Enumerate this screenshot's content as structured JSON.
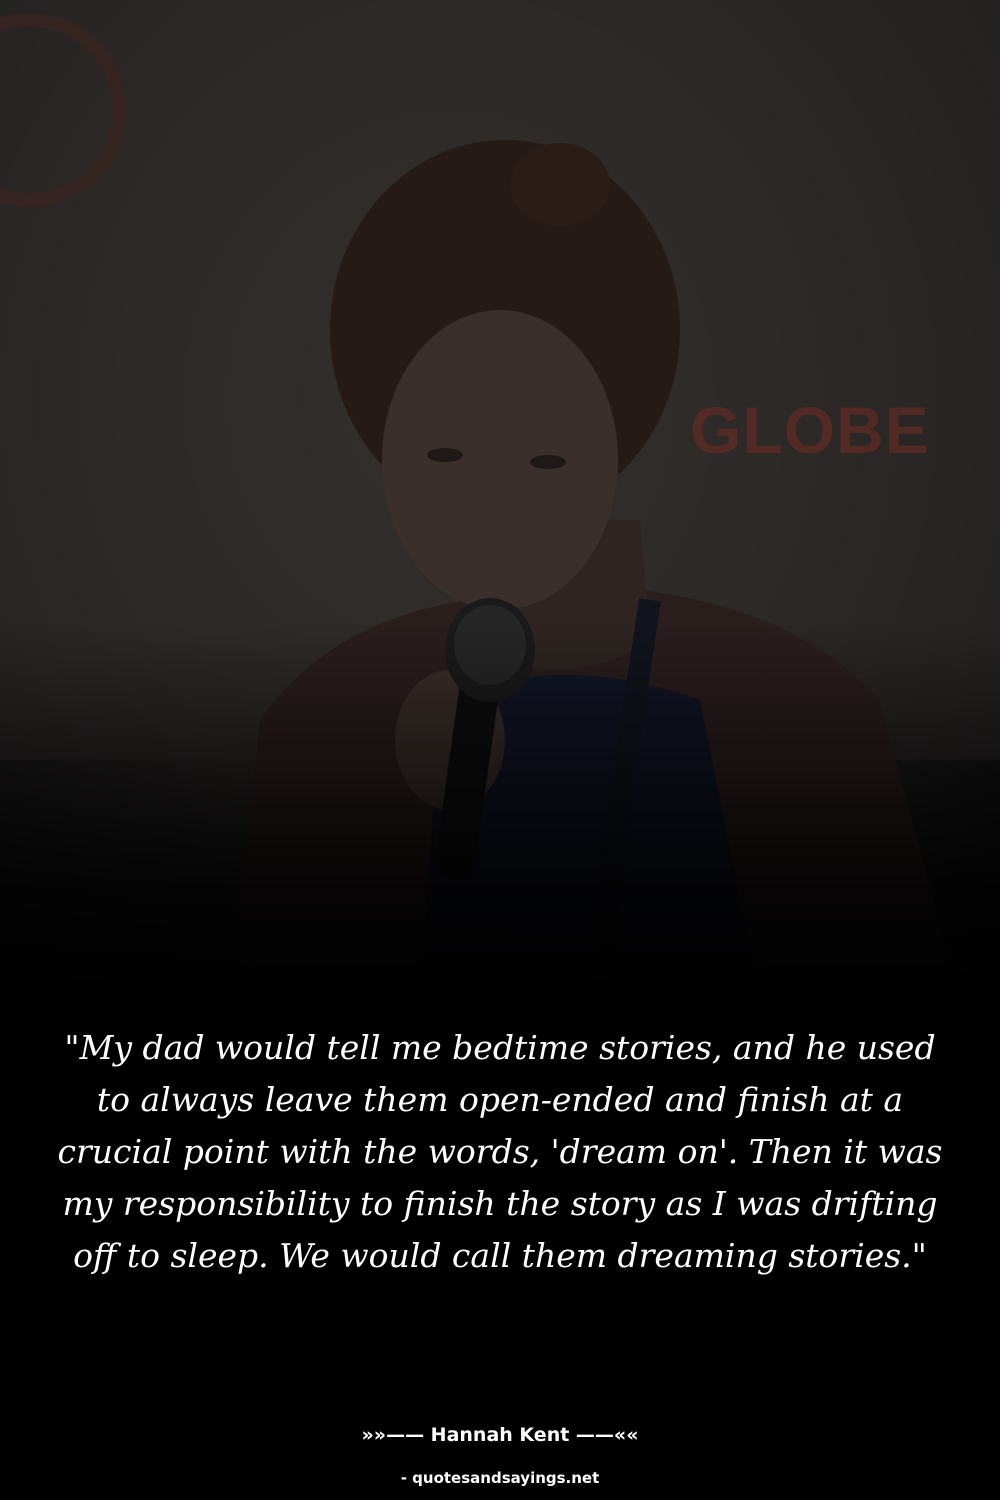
{
  "background_text": "GLOBE",
  "quote": "\"My dad would tell me bedtime stories, and he used to always leave them open-ended and finish at a crucial point with the words, 'dream on'. Then it was my responsibility to finish the story as I was drifting off to sleep. We would call them dreaming stories.\"",
  "author": "»»—— Hannah Kent ——««",
  "source": "- quotesandsayings.net",
  "colors": {
    "background": "#000000",
    "text": "#ffffff",
    "sign": "#5a2b24"
  }
}
